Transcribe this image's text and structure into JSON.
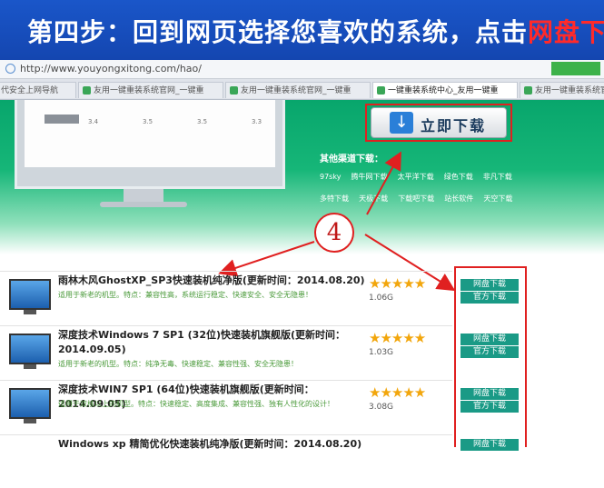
{
  "banner": {
    "title_main": "第四步：回到网页选择您喜欢的系统，点击",
    "title_highlight": "网盘下载"
  },
  "browser": {
    "url": "http://www.youyongxitong.com/hao/",
    "right_button": "",
    "tabs": [
      {
        "label": "代安全上网导航"
      },
      {
        "label": "友用一键重装系统官网_一键重"
      },
      {
        "label": "友用一键重装系统官网_一键重"
      },
      {
        "label": "一键重装系统中心_友用一键重"
      },
      {
        "label": "友用一键重装系统官网_一键重"
      }
    ]
  },
  "hero": {
    "download_button": "立即下载",
    "other_title": "其他渠道下载：",
    "other_links": [
      "97sky",
      "腾牛网下载",
      "太平洋下载",
      "绿色下载",
      "非凡下载",
      "多特下载",
      "天极下载",
      "下载吧下载",
      "站长软件",
      "天空下载"
    ],
    "monitor_numbers": [
      "3.4",
      "3.5",
      "3.5",
      "3.3"
    ]
  },
  "annotation": {
    "step_number": "4"
  },
  "software": [
    {
      "title": "雨林木风GhostXP_SP3快速装机纯净版(更新时间：2014.08.20)",
      "desc": "适用于新老的机型。特点：兼容性高，系统运行稳定、快速安全、安全无隐患！",
      "stars": "★★★★★",
      "size": "1.06G",
      "net_label": "网盘下载",
      "official_label": "官方下载"
    },
    {
      "title": "深度技术Windows 7 SP1 (32位)快速装机旗舰版(更新时间：2014.09.05)",
      "desc": "适用于新老的机型。特点：纯净无毒、快速稳定、兼容性强、安全无隐患！",
      "stars": "★★★★★",
      "size": "1.03G",
      "net_label": "网盘下载",
      "official_label": "官方下载"
    },
    {
      "title": "深度技术WIN7 SP1 (64位)快速装机旗舰版(更新时间：2014.09.05)",
      "desc": "适用于双核以上的机型。特点：快速稳定、高度集成、兼容性强、独有人性化的设计！",
      "stars": "★★★★★",
      "size": "3.08G",
      "net_label": "网盘下载",
      "official_label": "官方下载"
    },
    {
      "title": "Windows xp 精简优化快速装机纯净版(更新时间：2014.08.20)",
      "desc": "",
      "stars": "",
      "size": "",
      "net_label": "网盘下载",
      "official_label": ""
    }
  ],
  "colors": {
    "accent_red": "#e02020",
    "banner_blue": "#1a56c9",
    "download_green": "#1a9a86",
    "star": "#f2a60c"
  }
}
